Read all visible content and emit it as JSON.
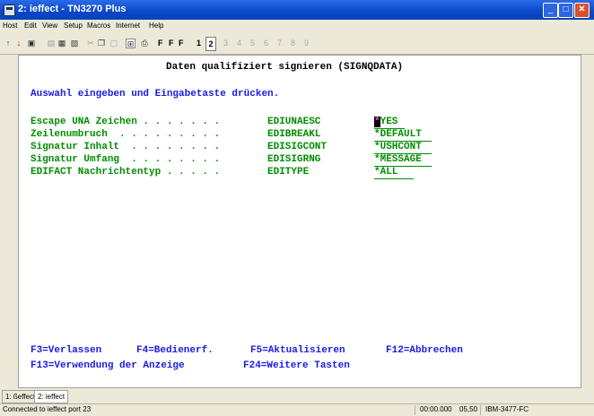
{
  "window": {
    "title": "2: ieffect - TN3270 Plus"
  },
  "menu": [
    "Host",
    "Edit",
    "View",
    "Setup",
    "Macros",
    "Internet",
    "Help"
  ],
  "toolbar": {
    "letters": [
      "F",
      "F",
      "F"
    ],
    "sessions": [
      "1",
      "2",
      "3",
      "4",
      "5",
      "6",
      "7",
      "8",
      "9"
    ]
  },
  "screen": {
    "title": "Daten qualifiziert signieren (SIGNQDATA)",
    "instruction": "Auswahl eingeben und Eingabetaste drücken.",
    "fields": [
      {
        "label": "Escape UNA Zeichen . . . . . . .",
        "keyword": "EDIUNAESC",
        "cursor": "*",
        "value": "YES"
      },
      {
        "label": "Zeilenumbruch  . . . . . . . . .",
        "keyword": "EDIBREAKL",
        "value": "*DEFAULT"
      },
      {
        "label": "Signatur Inhalt  . . . . . . . .",
        "keyword": "EDISIGCONT",
        "value": "*USHCONT"
      },
      {
        "label": "Signatur Umfang  . . . . . . . .",
        "keyword": "EDISIGRNG",
        "value": "*MESSAGE"
      },
      {
        "label": "EDIFACT Nachrichtentyp . . . . .",
        "keyword": "EDITYPE",
        "value": "*ALL"
      }
    ],
    "fkeys_row1": [
      "F3=Verlassen",
      "F4=Bedienerf.",
      "F5=Aktualisieren",
      "F12=Abbrechen"
    ],
    "fkeys_row2": [
      "F13=Verwendung der Anzeige",
      "F24=Weitere Tasten"
    ]
  },
  "tabs": [
    "1: ßeffect",
    "2: ieffect"
  ],
  "status": {
    "message": "Connected to ieffect port 23",
    "time": "00:00.000",
    "position": "05,50",
    "terminal": "IBM-3477-FC"
  }
}
